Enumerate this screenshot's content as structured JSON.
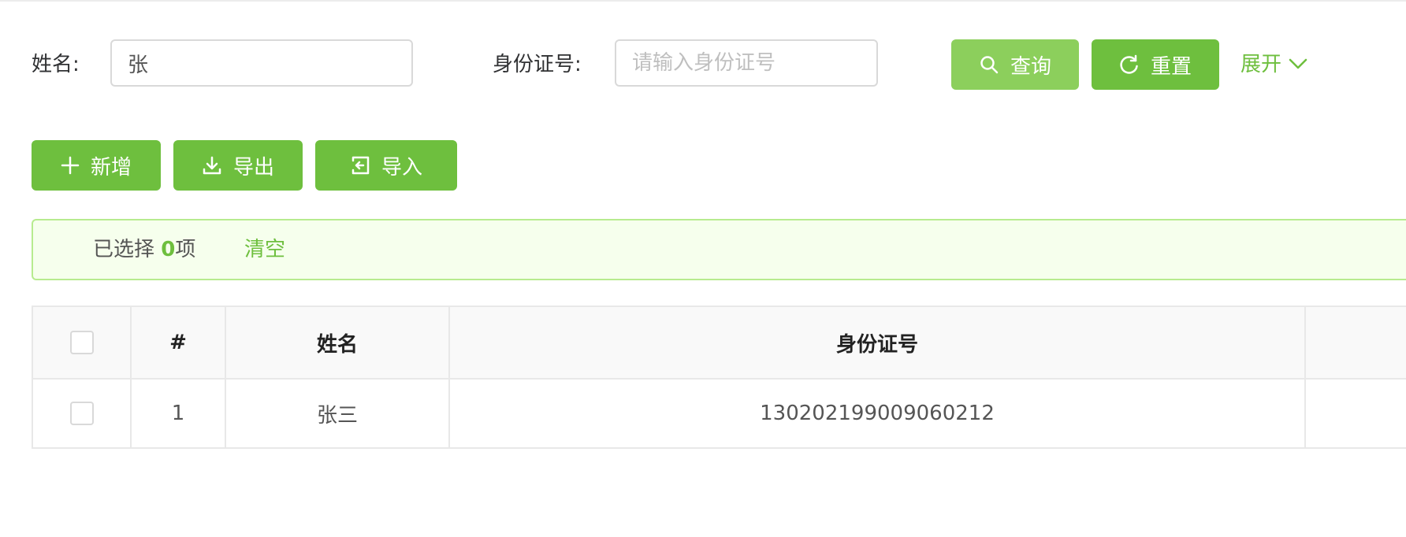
{
  "search": {
    "name_label": "姓名:",
    "name_value": "张",
    "id_label": "身份证号:",
    "id_value": "",
    "id_placeholder": "请输入身份证号",
    "query_label": "查询",
    "reset_label": "重置",
    "expand_label": "展开"
  },
  "actions": {
    "add_label": "新增",
    "export_label": "导出",
    "import_label": "导入"
  },
  "alert": {
    "prefix": "已选择 ",
    "count": "0",
    "suffix": "项",
    "clear_label": "清空"
  },
  "table": {
    "columns": [
      "",
      "#",
      "姓名",
      "身份证号",
      ""
    ],
    "rows": [
      {
        "index": "1",
        "name": "张三",
        "id_number": "130202199009060212"
      }
    ]
  },
  "colors": {
    "primary": "#6ebf3e",
    "primary_light": "#8ccf5c",
    "alert_bg": "#f6ffed",
    "alert_border": "#b7eb8f"
  }
}
